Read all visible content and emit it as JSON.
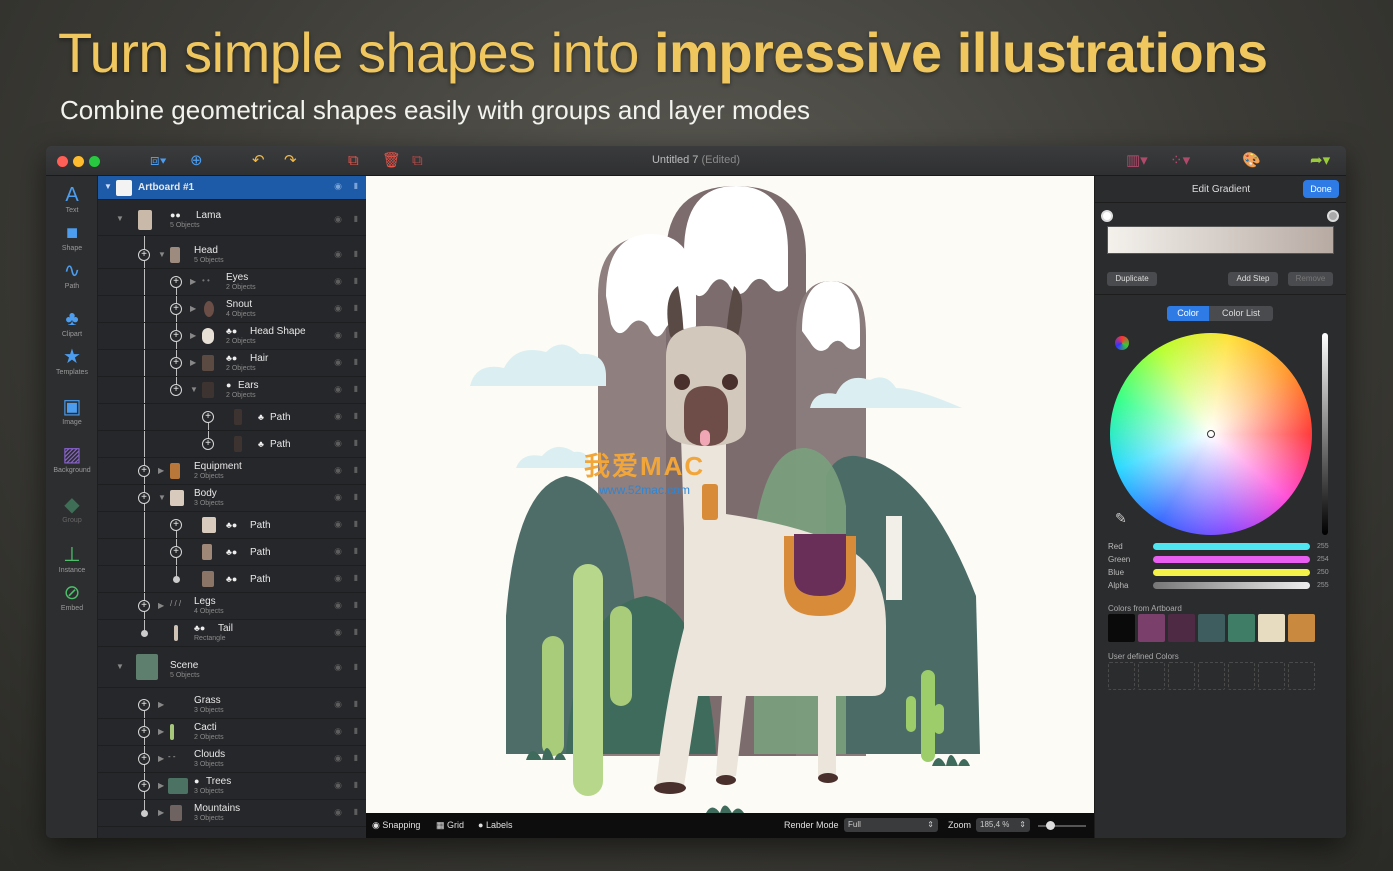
{
  "headline": {
    "normal": "Turn simple shapes into ",
    "bold": "impressive illustrations"
  },
  "subhead": "Combine geometrical shapes easily with groups and layer modes",
  "window": {
    "title": "Untitled 7",
    "edited": "(Edited)"
  },
  "tools": [
    {
      "label": "Text",
      "icon": "A"
    },
    {
      "label": "Shape",
      "icon": "■"
    },
    {
      "label": "Path",
      "icon": "∿"
    },
    {
      "label": "Clipart",
      "icon": "♣"
    },
    {
      "label": "Templates",
      "icon": "★"
    },
    {
      "label": "Image",
      "icon": "▣"
    },
    {
      "label": "Background",
      "icon": "▨"
    },
    {
      "label": "Group",
      "icon": "◆"
    },
    {
      "label": "Instance",
      "icon": "⊥"
    },
    {
      "label": "Embed",
      "icon": "⊘"
    }
  ],
  "layers": [
    {
      "name": "Artboard #1",
      "sub": ""
    },
    {
      "name": "Lama",
      "sub": "5 Objects"
    },
    {
      "name": "Head",
      "sub": "5 Objects"
    },
    {
      "name": "Eyes",
      "sub": "2 Objects"
    },
    {
      "name": "Snout",
      "sub": "4 Objects"
    },
    {
      "name": "Head Shape",
      "sub": "2 Objects"
    },
    {
      "name": "Hair",
      "sub": "2 Objects"
    },
    {
      "name": "Ears",
      "sub": "2 Objects"
    },
    {
      "name": "Path",
      "sub": ""
    },
    {
      "name": "Path",
      "sub": ""
    },
    {
      "name": "Equipment",
      "sub": "2 Objects"
    },
    {
      "name": "Body",
      "sub": "3 Objects"
    },
    {
      "name": "Path",
      "sub": ""
    },
    {
      "name": "Path",
      "sub": ""
    },
    {
      "name": "Path",
      "sub": ""
    },
    {
      "name": "Legs",
      "sub": "4 Objects"
    },
    {
      "name": "Tail",
      "sub": "Rectangle"
    },
    {
      "name": "Scene",
      "sub": "5 Objects"
    },
    {
      "name": "Grass",
      "sub": "3 Objects"
    },
    {
      "name": "Cacti",
      "sub": "2 Objects"
    },
    {
      "name": "Clouds",
      "sub": "3 Objects"
    },
    {
      "name": "Trees",
      "sub": "3 Objects"
    },
    {
      "name": "Mountains",
      "sub": "3 Objects"
    }
  ],
  "watermark": {
    "line1": "我爱MAC",
    "line2": "www.52mac.com"
  },
  "statusbar": {
    "snapping": "Snapping",
    "grid": "Grid",
    "labels": "Labels",
    "render_mode_label": "Render Mode",
    "render_mode_value": "Full",
    "zoom_label": "Zoom",
    "zoom_value": "185,4 %"
  },
  "inspector": {
    "title": "Edit Gradient",
    "done": "Done",
    "duplicate": "Duplicate",
    "add_step": "Add Step",
    "remove": "Remove",
    "tab_color": "Color",
    "tab_color_list": "Color List",
    "sliders": [
      {
        "label": "Red",
        "value": "255",
        "color": "#4fe6f2"
      },
      {
        "label": "Green",
        "value": "254",
        "color": "#e85ef0"
      },
      {
        "label": "Blue",
        "value": "250",
        "color": "#f4f24a"
      },
      {
        "label": "Alpha",
        "value": "255",
        "color": "#e6e6e6"
      }
    ],
    "artboard_colors_label": "Colors from Artboard",
    "user_colors_label": "User defined Colors",
    "artboard_colors": [
      "#0a0a0a",
      "#7a3f6a",
      "#4e2a45",
      "#3e5d5e",
      "#3f7d66",
      "#e8dcc0",
      "#c98a3f"
    ]
  }
}
